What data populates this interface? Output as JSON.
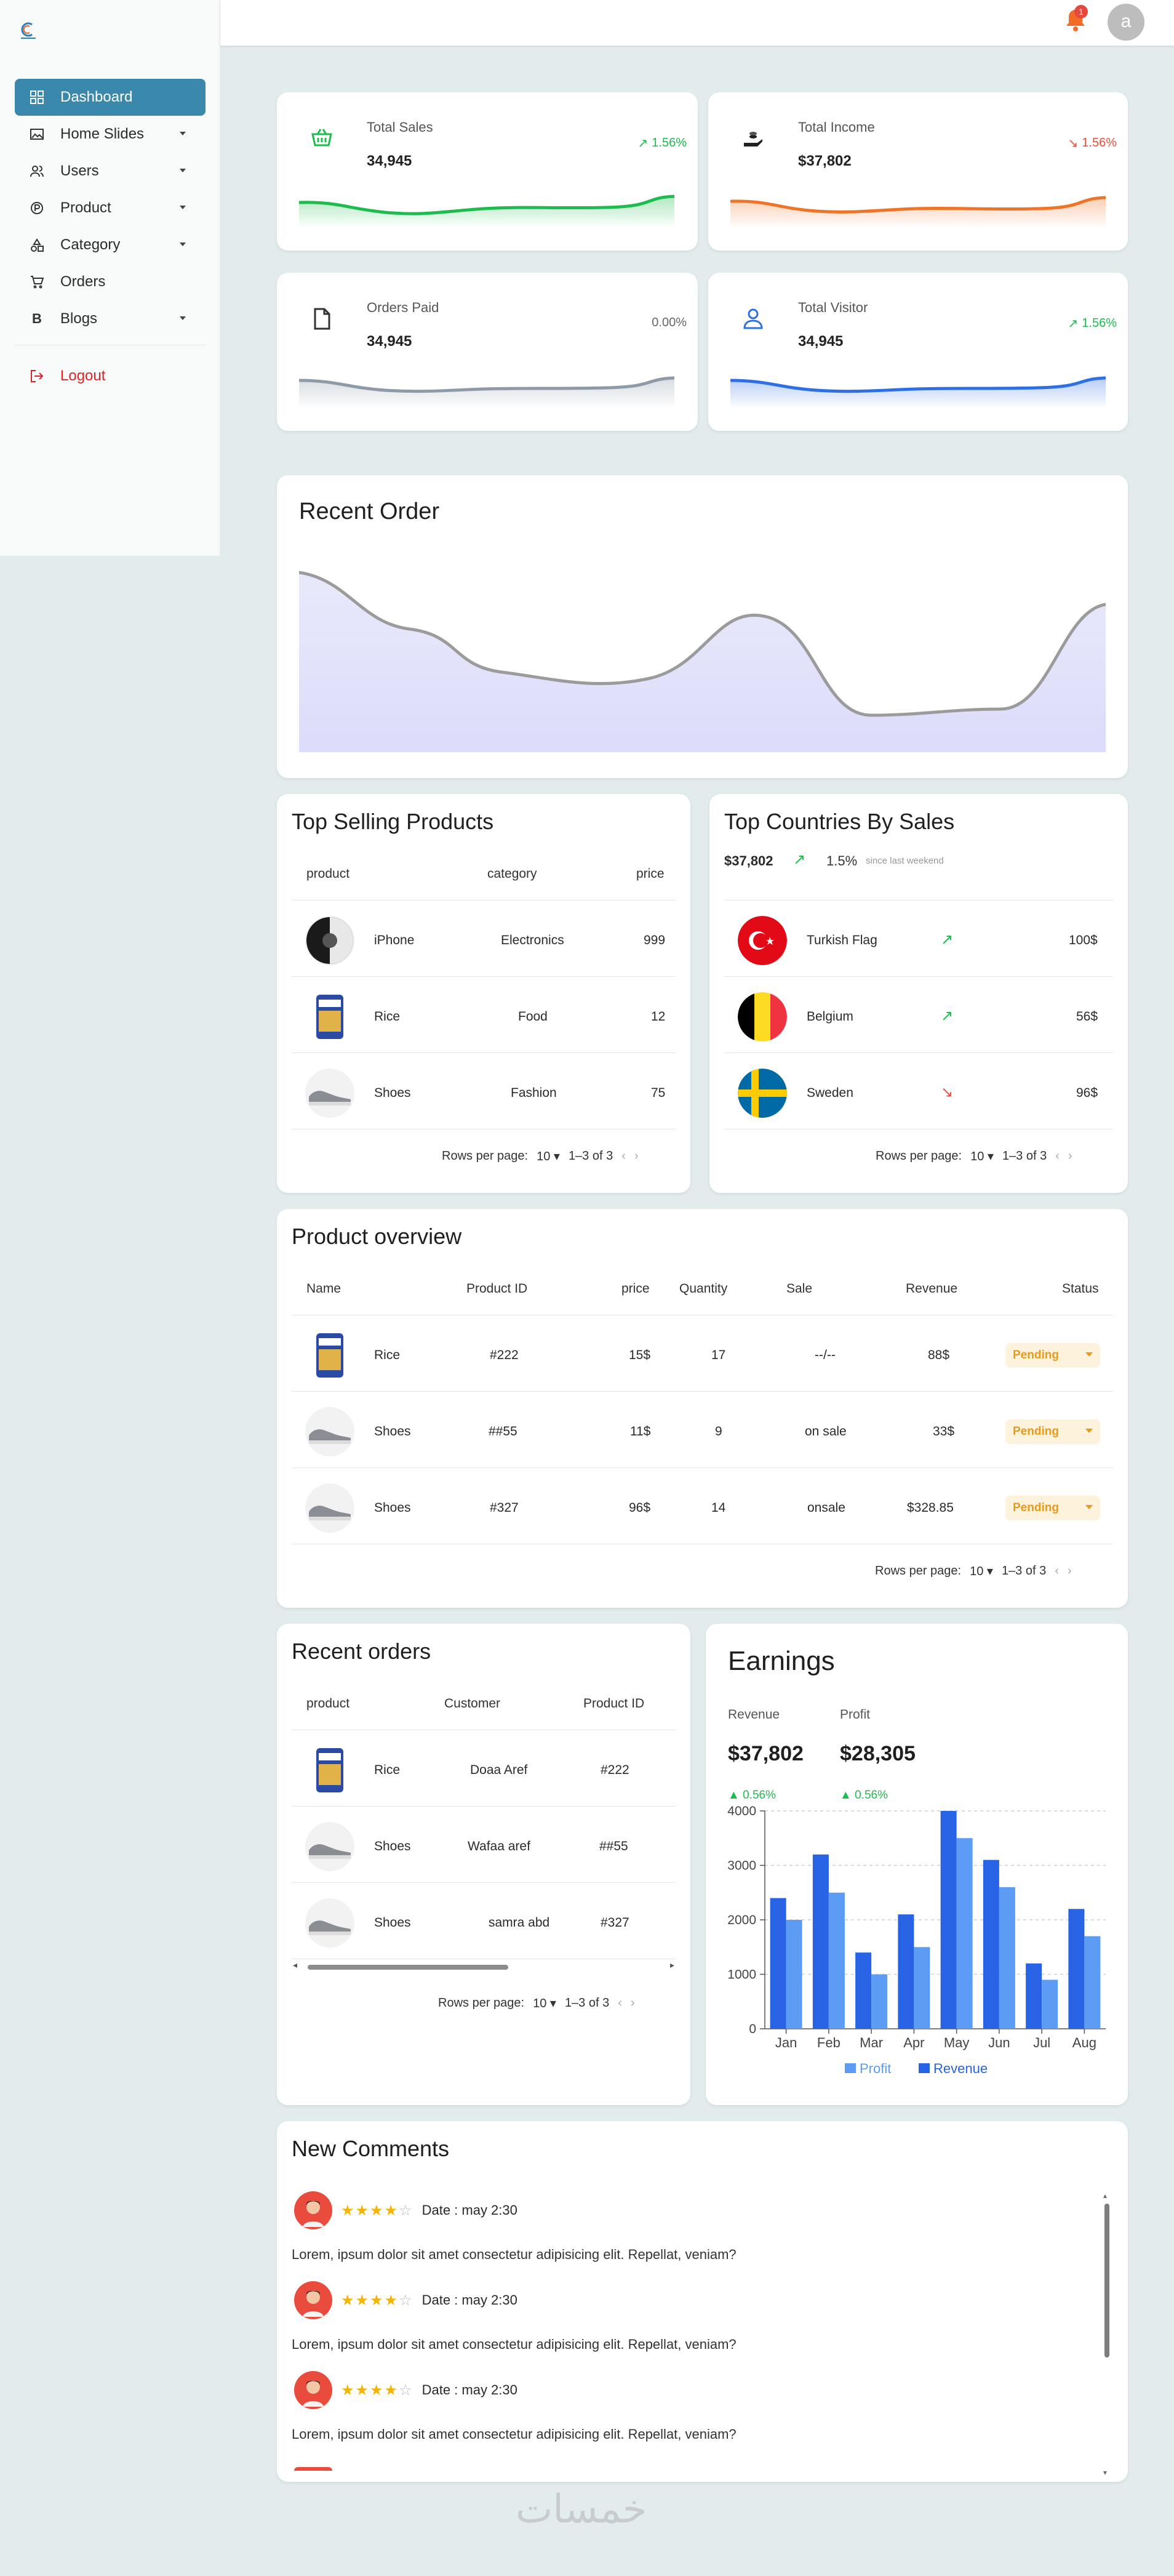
{
  "sidebar": {
    "items": [
      {
        "label": "Dashboard",
        "icon": "grid-icon"
      },
      {
        "label": "Home Slides",
        "icon": "image-icon"
      },
      {
        "label": "Users",
        "icon": "users-icon"
      },
      {
        "label": "Product",
        "icon": "product-icon"
      },
      {
        "label": "Category",
        "icon": "category-icon"
      },
      {
        "label": "Orders",
        "icon": "cart-icon"
      },
      {
        "label": "Blogs",
        "icon": "blog-icon"
      }
    ],
    "logout": "Logout"
  },
  "topbar": {
    "notification_count": "1",
    "avatar_letter": "a"
  },
  "stats": [
    {
      "label": "Total Sales",
      "value": "34,945",
      "trend": "1.56%",
      "color": "#1ebc4e"
    },
    {
      "label": "Total Income",
      "value": "$37,802",
      "trend": "1.56%",
      "color": "#f07428"
    },
    {
      "label": "Orders Paid",
      "value": "34,945",
      "trend": "0.00%",
      "color": "#8e9aa6"
    },
    {
      "label": "Total Visitor",
      "value": "34,945",
      "trend": "1.56%",
      "color": "#2f6fe6"
    }
  ],
  "recent_order": {
    "title": "Recent Order"
  },
  "top_selling": {
    "title": "Top Selling Products",
    "headers": [
      "product",
      "category",
      "price"
    ],
    "rows": [
      {
        "name": "iPhone",
        "category": "Electronics",
        "price": "999"
      },
      {
        "name": "Rice",
        "category": "Food",
        "price": "12"
      },
      {
        "name": "Shoes",
        "category": "Fashion",
        "price": "75"
      }
    ],
    "rows_per_page_label": "Rows per page:",
    "rows_per_page": "10",
    "range": "1–3 of 3"
  },
  "top_countries": {
    "title": "Top Countries By Sales",
    "total": "$37,802",
    "trend": "1.5%",
    "since": "since last weekend",
    "rows": [
      {
        "name": "Turkish Flag",
        "value": "100$",
        "up": true
      },
      {
        "name": "Belgium",
        "value": "56$",
        "up": true
      },
      {
        "name": "Sweden",
        "value": "96$",
        "up": false
      }
    ],
    "rows_per_page_label": "Rows per page:",
    "rows_per_page": "10",
    "range": "1–3 of 3"
  },
  "product_overview": {
    "title": "Product overview",
    "headers": [
      "Name",
      "Product ID",
      "price",
      "Quantity",
      "Sale",
      "Revenue",
      "Status"
    ],
    "rows": [
      {
        "name": "Rice",
        "id": "#222",
        "price": "15$",
        "qty": "17",
        "sale": "--/--",
        "revenue": "88$",
        "status": "Pending"
      },
      {
        "name": "Shoes",
        "id": "##55",
        "price": "11$",
        "qty": "9",
        "sale": "on sale",
        "revenue": "33$",
        "status": "Pending"
      },
      {
        "name": "Shoes",
        "id": "#327",
        "price": "96$",
        "qty": "14",
        "sale": "onsale",
        "revenue": "$328.85",
        "status": "Pending"
      }
    ],
    "rows_per_page_label": "Rows per page:",
    "rows_per_page": "10",
    "range": "1–3 of 3"
  },
  "recent_orders": {
    "title": "Recent orders",
    "headers": [
      "product",
      "Customer",
      "Product ID"
    ],
    "rows": [
      {
        "name": "Rice",
        "customer": "Doaa Aref",
        "id": "#222"
      },
      {
        "name": "Shoes",
        "customer": "Wafaa aref",
        "id": "##55"
      },
      {
        "name": "Shoes",
        "customer": "samra abd",
        "id": "#327"
      }
    ],
    "rows_per_page_label": "Rows per page:",
    "rows_per_page": "10",
    "range": "1–3 of 3"
  },
  "earnings": {
    "title": "Earnings",
    "revenue_label": "Revenue",
    "revenue_value": "$37,802",
    "revenue_trend": "0.56%",
    "profit_label": "Profit",
    "profit_value": "$28,305",
    "profit_trend": "0.56%"
  },
  "chart_data": {
    "type": "bar",
    "categories": [
      "Jan",
      "Feb",
      "Mar",
      "Apr",
      "May",
      "Jun",
      "Jul",
      "Aug"
    ],
    "series": [
      {
        "name": "Revenue",
        "color": "#2863e6",
        "values": [
          2400,
          3200,
          1400,
          2100,
          4000,
          3100,
          1200,
          2200
        ]
      },
      {
        "name": "Profit",
        "color": "#5c9cf5",
        "values": [
          2000,
          2500,
          1000,
          1500,
          3500,
          2600,
          900,
          1700
        ]
      }
    ],
    "ylim": [
      0,
      4000
    ],
    "yticks": [
      0,
      1000,
      2000,
      3000,
      4000
    ],
    "legend": "bottom",
    "grid": true
  },
  "comments": {
    "title": "New Comments",
    "items": [
      {
        "date": "Date : may 2:30",
        "rating": 4,
        "text": "Lorem, ipsum dolor sit amet consectetur adipisicing elit. Repellat, veniam?"
      },
      {
        "date": "Date : may 2:30",
        "rating": 4,
        "text": "Lorem, ipsum dolor sit amet consectetur adipisicing elit. Repellat, veniam?"
      },
      {
        "date": "Date : may 2:30",
        "rating": 4,
        "text": "Lorem, ipsum dolor sit amet consectetur adipisicing elit. Repellat, veniam?"
      }
    ]
  },
  "footer": {
    "watermark": "خمسات"
  }
}
